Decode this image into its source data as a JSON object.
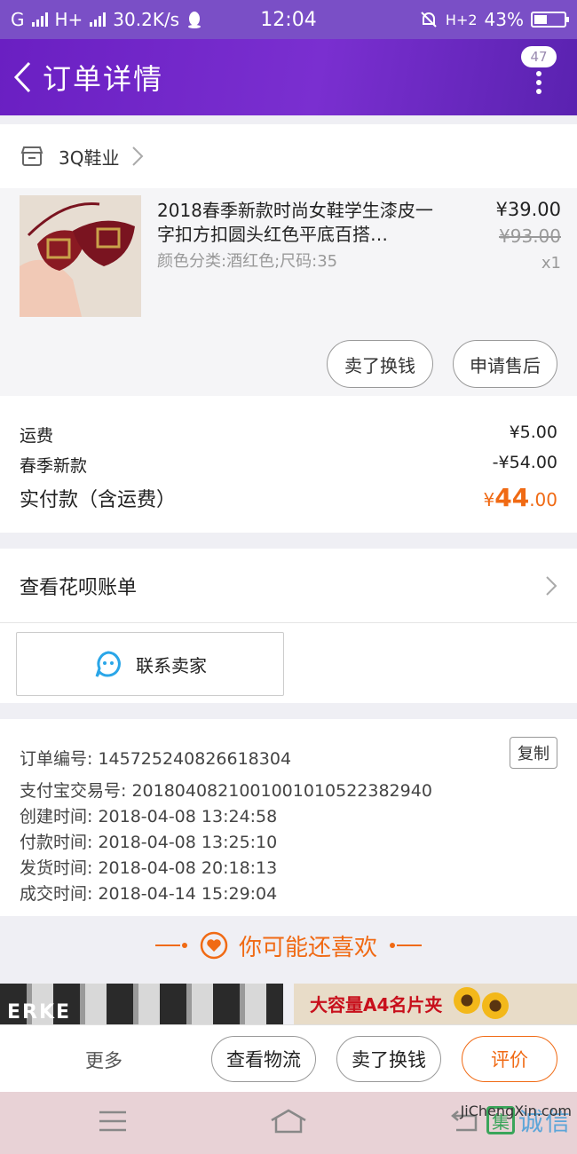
{
  "status_bar": {
    "carrier": "G",
    "network": "H+",
    "speed": "30.2K/s",
    "time": "12:04",
    "network_right": "H+2",
    "battery": "43%",
    "battery_level": 0.43
  },
  "header": {
    "title": "订单详情",
    "badge_count": "47"
  },
  "store": {
    "name": "3Q鞋业"
  },
  "item": {
    "name": "2018春季新款时尚女鞋学生漆皮一字扣方扣圆头红色平底百搭…",
    "spec": "颜色分类:酒红色;尺码:35",
    "price": "¥39.00",
    "original_price": "¥93.00",
    "quantity": "x1",
    "actions": [
      "卖了换钱",
      "申请售后"
    ]
  },
  "fees": {
    "shipping_label": "运费",
    "shipping_value": "¥5.00",
    "discount_label": "春季新款",
    "discount_value": "-¥54.00",
    "paid_label": "实付款（含运费）",
    "paid_currency": "¥",
    "paid_int": "44",
    "paid_dec": ".00"
  },
  "huabei": {
    "label": "查看花呗账单"
  },
  "contact": {
    "label": "联系卖家"
  },
  "order_info": {
    "copy_label": "复制",
    "lines": [
      "订单编号: 145725240826618304",
      "支付宝交易号: 2018040821001001010522382940",
      "创建时间: 2018-04-08 13:24:58",
      "付款时间: 2018-04-08 13:25:10",
      "发货时间: 2018-04-08 20:18:13",
      "成交时间: 2018-04-14 15:29:04"
    ]
  },
  "recommend": {
    "title": "你可能还喜欢",
    "card1_brand": "ERKE",
    "card2_slogan": "大容量A4名片夹"
  },
  "bottom_bar": {
    "more": "更多",
    "buttons": [
      "查看物流",
      "卖了换钱",
      "评价"
    ]
  },
  "watermark": {
    "text": "诚信",
    "logo": "集",
    "url": "JiChengXin.com"
  },
  "colors": {
    "accent": "#f06a14",
    "header": "#6a1fc2",
    "statusbar": "#7a4fc6"
  }
}
